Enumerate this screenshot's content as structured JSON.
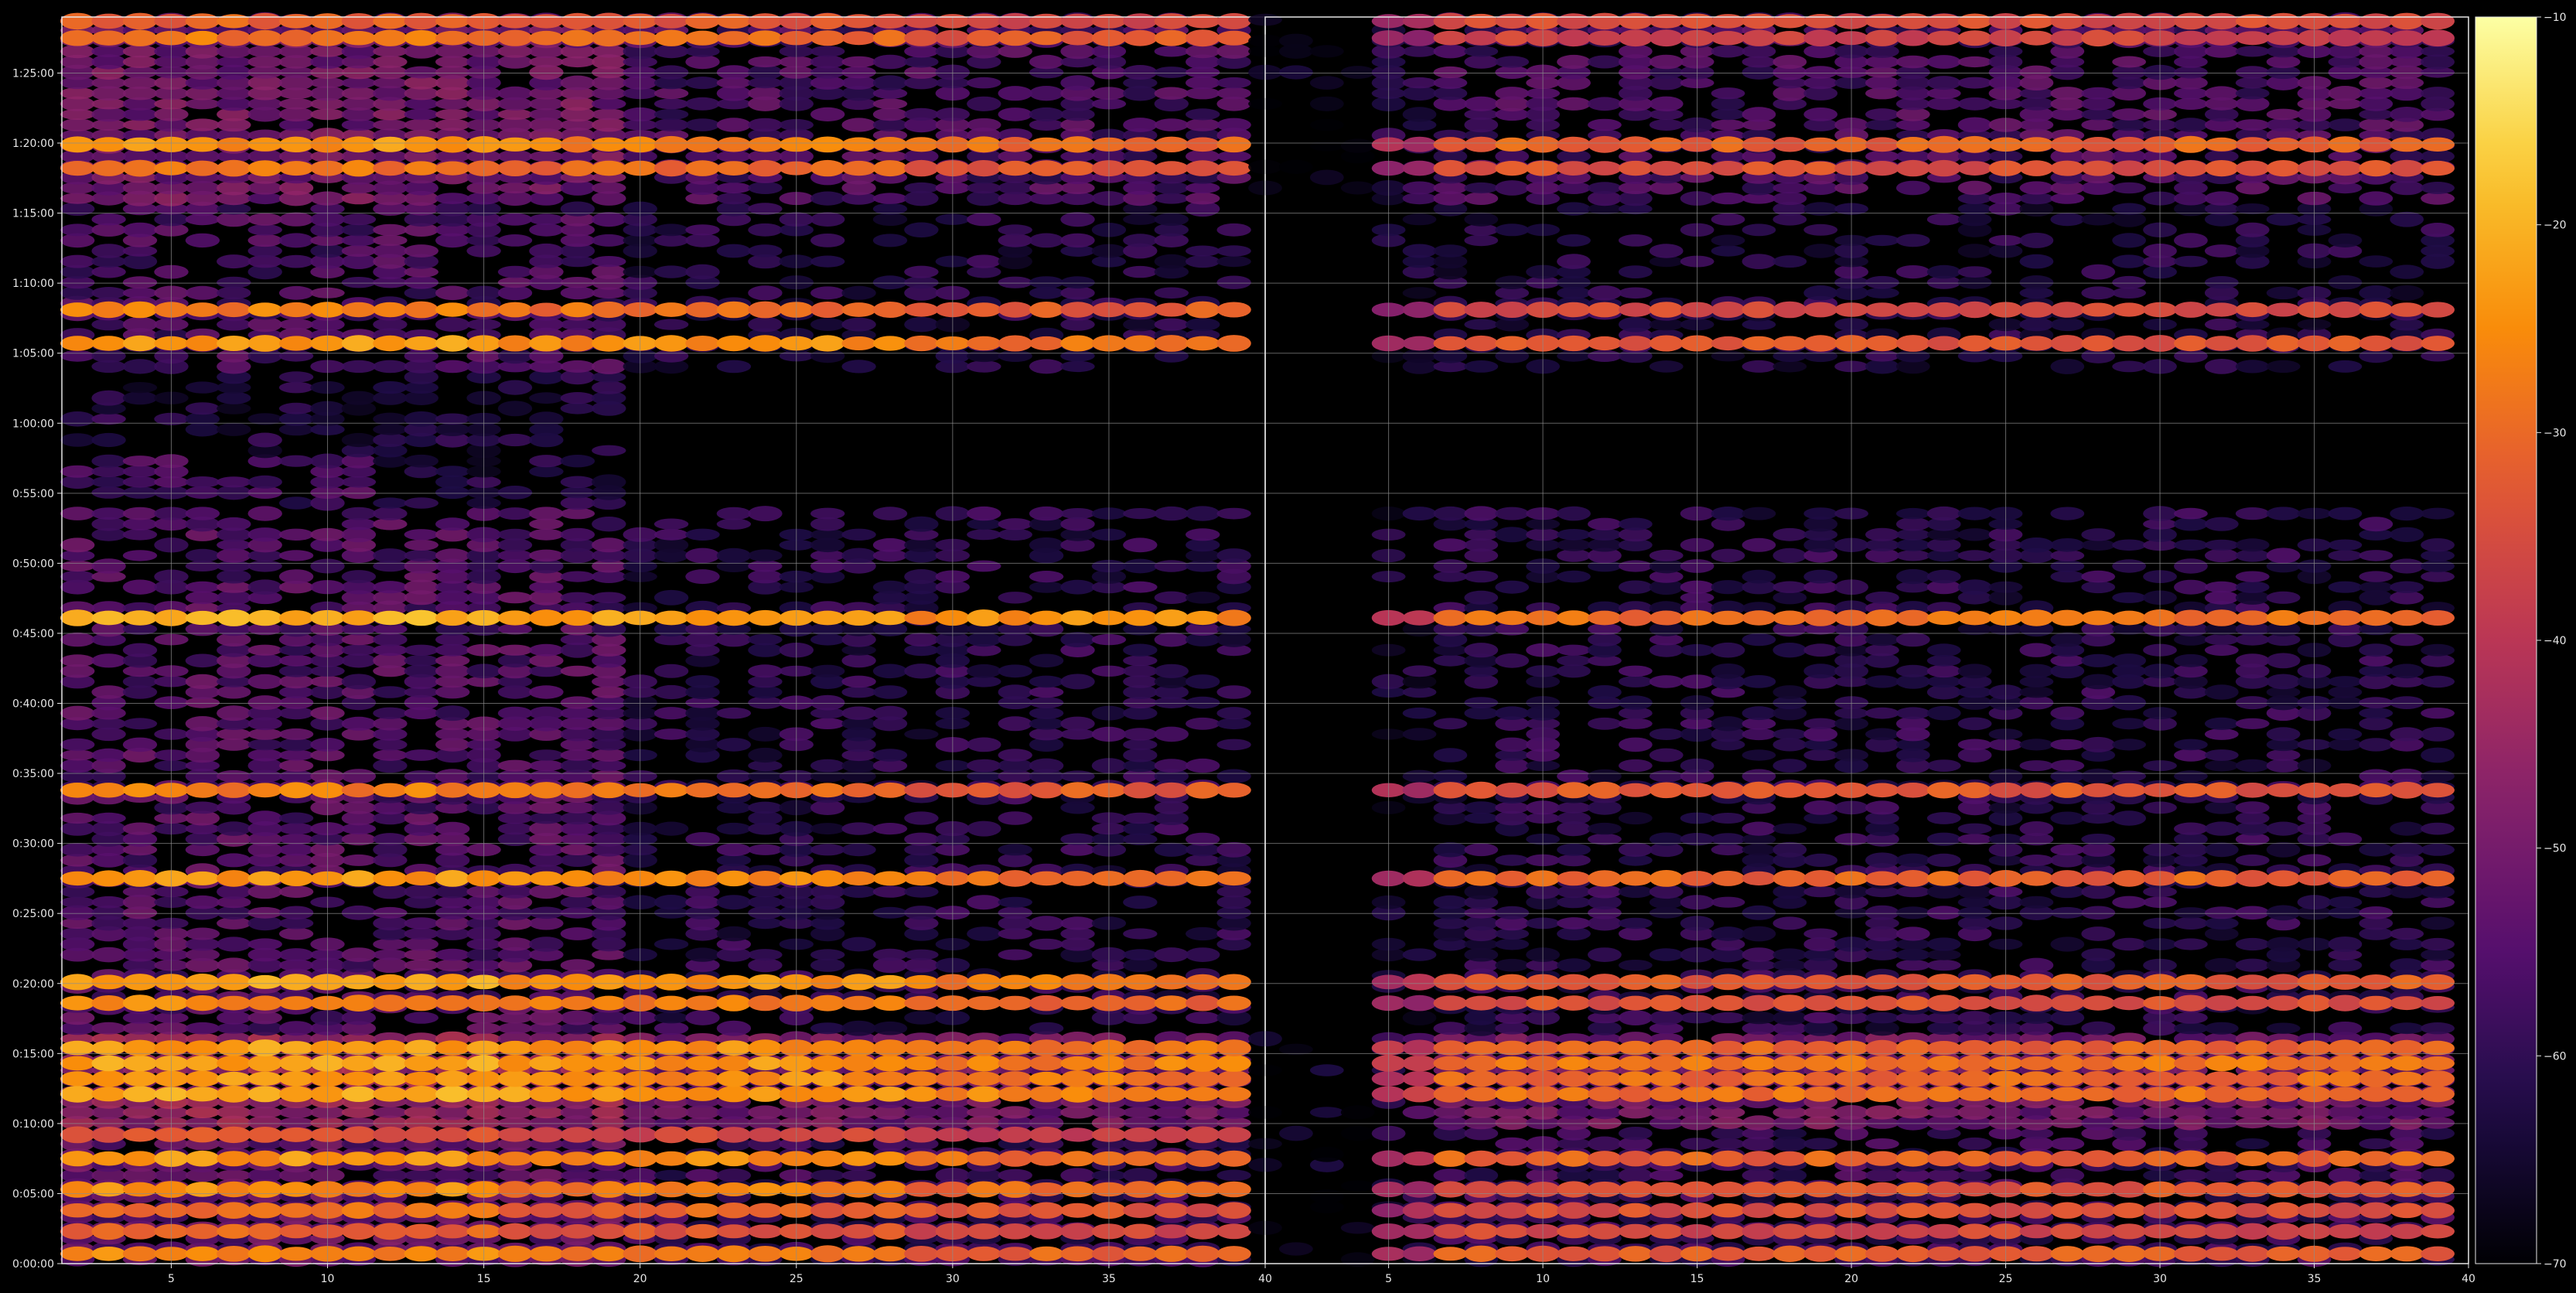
{
  "chart_data": {
    "type": "heatmap",
    "title": "",
    "colormap": "inferno",
    "background_color": "#000000",
    "grid": true,
    "grid_color": "#8c8c8c",
    "panels": [
      {
        "name": "left",
        "xlim": [
          1.5,
          40
        ],
        "x_ticks": [
          5,
          10,
          15,
          20,
          25,
          30,
          35,
          40
        ]
      },
      {
        "name": "right",
        "xlim": [
          1,
          40
        ],
        "x_ticks": [
          5,
          10,
          15,
          20,
          25,
          30,
          35,
          40
        ]
      }
    ],
    "y_axis": {
      "unit": "minutes",
      "range": [
        0,
        89
      ],
      "ticks": [
        0,
        5,
        10,
        15,
        20,
        25,
        30,
        35,
        40,
        45,
        50,
        55,
        60,
        65,
        70,
        75,
        80,
        85
      ],
      "tick_labels": [
        "0:00:00",
        "0:05:00",
        "0:10:00",
        "0:15:00",
        "0:20:00",
        "0:25:00",
        "0:30:00",
        "0:35:00",
        "0:40:00",
        "0:45:00",
        "0:50:00",
        "0:55:00",
        "1:00:00",
        "1:05:00",
        "1:10:00",
        "1:15:00",
        "1:20:00",
        "1:25:00"
      ]
    },
    "colorbar": {
      "range": [
        -70,
        -10
      ],
      "ticks": [
        -70,
        -60,
        -50,
        -40,
        -30,
        -20,
        -10
      ],
      "tick_labels": [
        "−70",
        "−60",
        "−50",
        "−40",
        "−30",
        "−20",
        "−10"
      ]
    },
    "strong_bands_left": [
      {
        "time": 0.7,
        "value": -28
      },
      {
        "time": 2.3,
        "value": -33
      },
      {
        "time": 3.8,
        "value": -31
      },
      {
        "time": 5.3,
        "value": -27
      },
      {
        "time": 7.5,
        "value": -26
      },
      {
        "time": 9.2,
        "value": -36
      },
      {
        "time": 12.1,
        "value": -23
      },
      {
        "time": 13.2,
        "value": -25
      },
      {
        "time": 14.3,
        "value": -24
      },
      {
        "time": 15.4,
        "value": -25
      },
      {
        "time": 18.6,
        "value": -28
      },
      {
        "time": 20.1,
        "value": -24
      },
      {
        "time": 27.5,
        "value": -26
      },
      {
        "time": 33.8,
        "value": -29
      },
      {
        "time": 46.1,
        "value": -22
      },
      {
        "time": 65.7,
        "value": -25
      },
      {
        "time": 68.1,
        "value": -29
      },
      {
        "time": 78.2,
        "value": -30
      },
      {
        "time": 79.9,
        "value": -26
      },
      {
        "time": 87.5,
        "value": -30
      },
      {
        "time": 88.7,
        "value": -33
      }
    ],
    "strong_bands_right": [
      {
        "time": 0.7,
        "value": -32
      },
      {
        "time": 2.3,
        "value": -36
      },
      {
        "time": 3.8,
        "value": -34
      },
      {
        "time": 5.3,
        "value": -33
      },
      {
        "time": 7.5,
        "value": -31
      },
      {
        "time": 12.1,
        "value": -29
      },
      {
        "time": 13.2,
        "value": -30
      },
      {
        "time": 14.3,
        "value": -28
      },
      {
        "time": 15.4,
        "value": -31
      },
      {
        "time": 18.6,
        "value": -34
      },
      {
        "time": 20.1,
        "value": -32
      },
      {
        "time": 27.5,
        "value": -31
      },
      {
        "time": 33.8,
        "value": -33
      },
      {
        "time": 46.1,
        "value": -29
      },
      {
        "time": 65.7,
        "value": -33
      },
      {
        "time": 68.1,
        "value": -35
      },
      {
        "time": 78.2,
        "value": -34
      },
      {
        "time": 79.9,
        "value": -31
      },
      {
        "time": 87.5,
        "value": -37
      },
      {
        "time": 88.7,
        "value": -35
      }
    ],
    "notes": "Right panel has no data below x≈5 except faint marks; left panel shows extra low-x activity around 0:55:00–0:58:00 and 1:10:00–1:17:00."
  }
}
